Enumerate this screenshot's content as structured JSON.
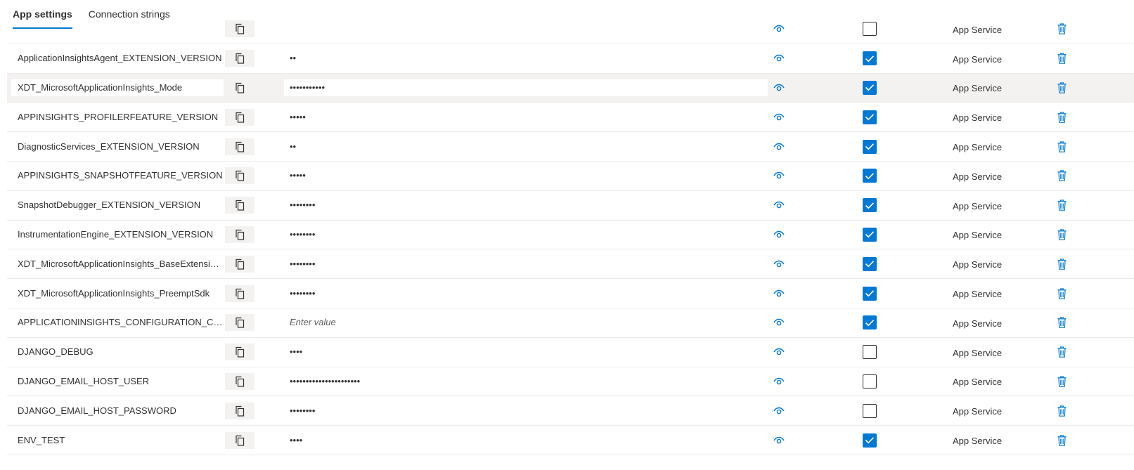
{
  "tabs": [
    {
      "label": "App settings",
      "active": true
    },
    {
      "label": "Connection strings",
      "active": false
    }
  ],
  "source_label": "App Service",
  "colors": {
    "accent": "#0078d4",
    "selected_row": "#f3f2f1"
  },
  "icons": {
    "copy": "copy-icon",
    "show": "eye-icon",
    "delete": "trash-icon"
  },
  "rows": [
    {
      "name": "",
      "value": "",
      "placeholder": false,
      "slot": false,
      "selected": false
    },
    {
      "name": "ApplicationInsightsAgent_EXTENSION_VERSION",
      "value": "••",
      "placeholder": false,
      "slot": true,
      "selected": false
    },
    {
      "name": "XDT_MicrosoftApplicationInsights_Mode",
      "value": "•••••••••••",
      "placeholder": false,
      "slot": true,
      "selected": true
    },
    {
      "name": "APPINSIGHTS_PROFILERFEATURE_VERSION",
      "value": "•••••",
      "placeholder": false,
      "slot": true,
      "selected": false
    },
    {
      "name": "DiagnosticServices_EXTENSION_VERSION",
      "value": "••",
      "placeholder": false,
      "slot": true,
      "selected": false
    },
    {
      "name": "APPINSIGHTS_SNAPSHOTFEATURE_VERSION",
      "value": "•••••",
      "placeholder": false,
      "slot": true,
      "selected": false
    },
    {
      "name": "SnapshotDebugger_EXTENSION_VERSION",
      "value": "••••••••",
      "placeholder": false,
      "slot": true,
      "selected": false
    },
    {
      "name": "InstrumentationEngine_EXTENSION_VERSION",
      "value": "••••••••",
      "placeholder": false,
      "slot": true,
      "selected": false
    },
    {
      "name": "XDT_MicrosoftApplicationInsights_BaseExtensions",
      "value": "••••••••",
      "placeholder": false,
      "slot": true,
      "selected": false
    },
    {
      "name": "XDT_MicrosoftApplicationInsights_PreemptSdk",
      "value": "••••••••",
      "placeholder": false,
      "slot": true,
      "selected": false
    },
    {
      "name": "APPLICATIONINSIGHTS_CONFIGURATION_CONT…",
      "value": "Enter value",
      "placeholder": true,
      "slot": true,
      "selected": false
    },
    {
      "name": "DJANGO_DEBUG",
      "value": "••••",
      "placeholder": false,
      "slot": false,
      "selected": false
    },
    {
      "name": "DJANGO_EMAIL_HOST_USER",
      "value": "••••••••••••••••••••••",
      "placeholder": false,
      "slot": false,
      "selected": false
    },
    {
      "name": "DJANGO_EMAIL_HOST_PASSWORD",
      "value": "••••••••",
      "placeholder": false,
      "slot": false,
      "selected": false
    },
    {
      "name": "ENV_TEST",
      "value": "••••",
      "placeholder": false,
      "slot": true,
      "selected": false
    }
  ]
}
